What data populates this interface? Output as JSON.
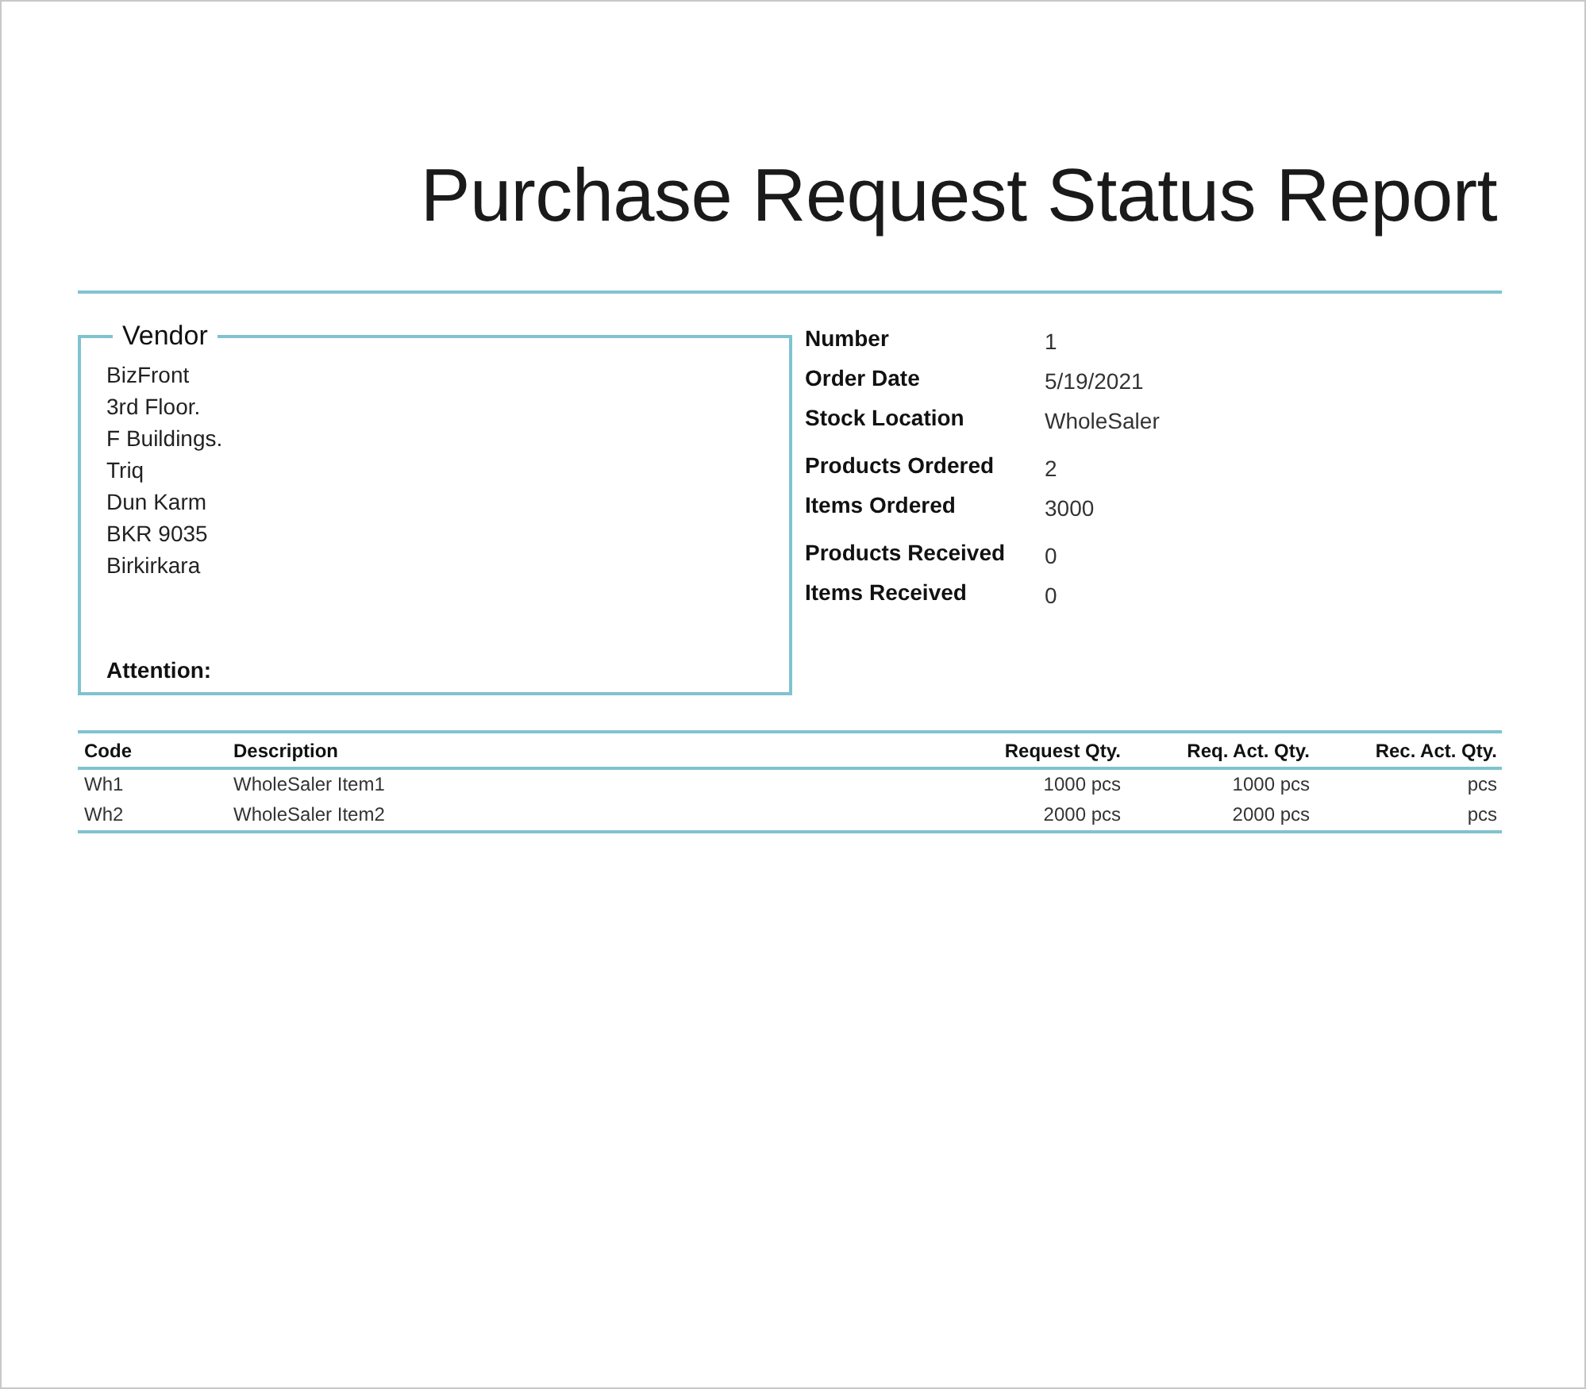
{
  "title": "Purchase Request Status Report",
  "vendor": {
    "heading": "Vendor",
    "address": [
      "BizFront",
      "3rd Floor.",
      "F Buildings.",
      "Triq",
      "Dun Karm",
      "BKR 9035",
      "Birkirkara"
    ],
    "attention_label": "Attention:"
  },
  "details": [
    [
      {
        "label": "Number",
        "value": "1"
      },
      {
        "label": "Order Date",
        "value": "5/19/2021"
      },
      {
        "label": "Stock Location",
        "value": "WholeSaler"
      }
    ],
    [
      {
        "label": "Products Ordered",
        "value": "2"
      },
      {
        "label": "Items Ordered",
        "value": "3000"
      }
    ],
    [
      {
        "label": "Products Received",
        "value": "0"
      },
      {
        "label": "Items Received",
        "value": "0"
      }
    ]
  ],
  "table": {
    "columns": [
      {
        "label": "Code",
        "kind": "text"
      },
      {
        "label": "Description",
        "kind": "text"
      },
      {
        "label": "Request Qty.",
        "kind": "quantity"
      },
      {
        "label": "Req. Act. Qty.",
        "kind": "quantity"
      },
      {
        "label": "Rec. Act. Qty.",
        "kind": "quantity"
      }
    ],
    "rows": [
      [
        "Wh1",
        "WholeSaler Item1",
        "1000 pcs",
        "1000 pcs",
        "pcs"
      ],
      [
        "Wh2",
        "WholeSaler Item2",
        "2000 pcs",
        "2000 pcs",
        "pcs"
      ]
    ]
  }
}
